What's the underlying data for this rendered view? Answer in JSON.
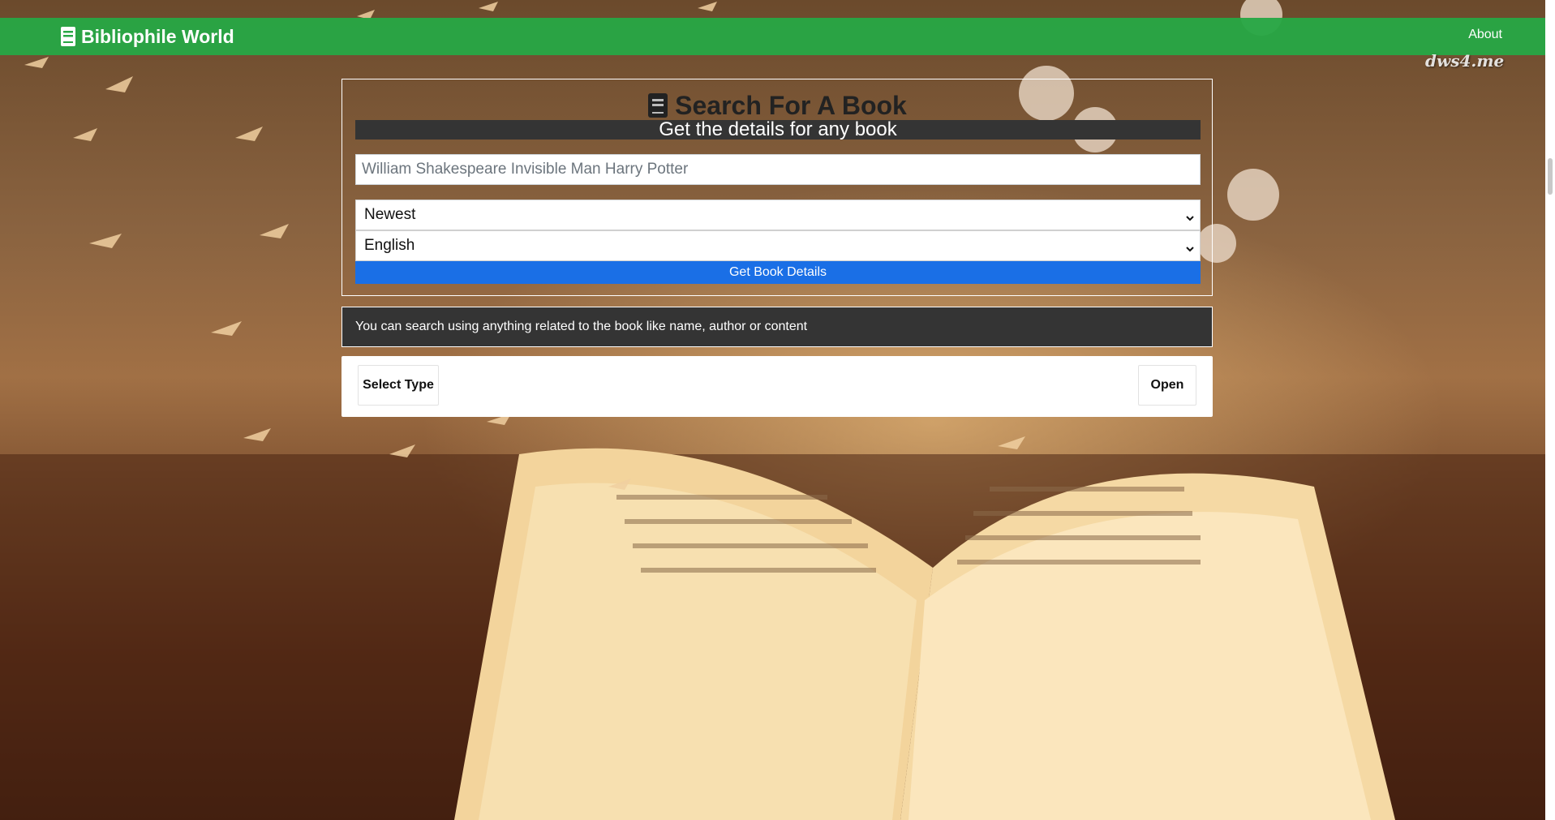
{
  "navbar": {
    "brand": "Bibliophile World",
    "brand_icon": "book-icon",
    "about_label": "About",
    "bg_color": "#28a745"
  },
  "watermark": "dws4.me",
  "search": {
    "title": "Search For A Book",
    "title_icon": "book-icon",
    "subtitle": "Get the details for any book",
    "input_value": "",
    "input_placeholder": "William Shakespeare Invisible Man Harry Potter",
    "sort_selected": "Newest",
    "language_selected": "English",
    "submit_label": "Get Book Details",
    "submit_color": "#1a6fe6"
  },
  "info": {
    "text": "You can search using anything related to the book like name, author or content",
    "bg_color": "#343434"
  },
  "actions": {
    "select_type_label": "Select Type",
    "open_label": "Open"
  }
}
